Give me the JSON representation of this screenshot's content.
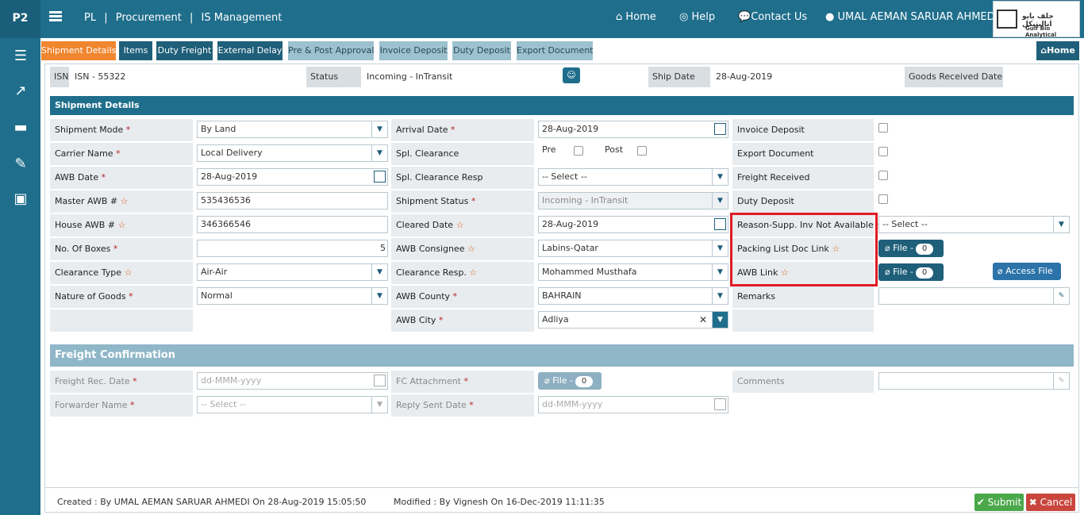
{
  "app": {
    "brand": "P2",
    "crumbs": [
      "PL",
      "|",
      "Procurement",
      "|",
      "IS Management"
    ]
  },
  "topnav": {
    "home": "Home",
    "help": "Help",
    "contact": "Contact Us",
    "user": "UMAL AEMAN SARUAR AHMEDI"
  },
  "logo": {
    "arabic": "جلف بايو اناليتيكل",
    "english": "Gulf Bio Analytical"
  },
  "tabs": [
    "Shipment Details",
    "Items",
    "Duty Freight",
    "External Delay",
    "Pre & Post Approval",
    "Invoice Deposit",
    "Duty Deposit",
    "Export Document"
  ],
  "home_button": "Home",
  "header": {
    "isn_label": "ISN",
    "isn_value": "ISN - 55322",
    "status_label": "Status",
    "status_value": "Incoming - InTransit",
    "ship_date_label": "Ship Date",
    "ship_date_value": "28-Aug-2019",
    "goods_label": "Goods Received Date"
  },
  "shipment": {
    "title": "Shipment Details",
    "col1": [
      {
        "label": "Shipment Mode",
        "mark": "*",
        "value": "By Land"
      },
      {
        "label": "Carrier Name",
        "mark": "*",
        "value": "Local Delivery"
      },
      {
        "label": "AWB Date",
        "mark": "*",
        "value": "28-Aug-2019"
      },
      {
        "label": "Master AWB #",
        "mark": "☆",
        "value": "535436536"
      },
      {
        "label": "House AWB #",
        "mark": "☆",
        "value": "346366546"
      },
      {
        "label": "No. Of Boxes",
        "mark": "*",
        "value": "5"
      },
      {
        "label": "Clearance Type",
        "mark": "☆",
        "value": "Air-Air"
      },
      {
        "label": "Nature of Goods",
        "mark": "*",
        "value": "Normal"
      }
    ],
    "col2": [
      {
        "label": "Arrival Date",
        "mark": "*",
        "value": "28-Aug-2019"
      },
      {
        "label": "Spl. Clearance",
        "mark": "",
        "value": ""
      },
      {
        "label": "Spl. Clearance Resp",
        "mark": "",
        "value": "-- Select --"
      },
      {
        "label": "Shipment Status",
        "mark": "*",
        "value": "Incoming - InTransit"
      },
      {
        "label": "Cleared Date",
        "mark": "☆",
        "value": "28-Aug-2019"
      },
      {
        "label": "AWB Consignee",
        "mark": "☆",
        "value": "Labins-Qatar"
      },
      {
        "label": "Clearance Resp.",
        "mark": "☆",
        "value": "Mohammed Musthafa"
      },
      {
        "label": "AWB County",
        "mark": "*",
        "value": "BAHRAIN"
      },
      {
        "label": "AWB City",
        "mark": "*",
        "value": "Adliya"
      }
    ],
    "pre_label": "Pre",
    "post_label": "Post",
    "col3": [
      {
        "label": "Invoice Deposit",
        "mark": ""
      },
      {
        "label": "Export Document",
        "mark": ""
      },
      {
        "label": "Freight Received",
        "mark": ""
      },
      {
        "label": "Duty Deposit",
        "mark": ""
      },
      {
        "label": "Reason-Supp. Inv Not Available",
        "mark": "☆"
      },
      {
        "label": "Packing List Doc Link",
        "mark": "☆"
      },
      {
        "label": "AWB Link",
        "mark": "☆"
      },
      {
        "label": "Remarks",
        "mark": ""
      }
    ],
    "reason_select": "-- Select --",
    "file_label": "File -",
    "file_count": "0",
    "access_file": "Access File"
  },
  "freight": {
    "title": "Freight Confirmation",
    "rec_date_label": "Freight Rec. Date",
    "rec_date_ph": "dd-MMM-yyyy",
    "forwarder_label": "Forwarder Name",
    "forwarder_value": "-- Select --",
    "fc_label": "FC Attachment",
    "fc_file": "File -",
    "fc_count": "0",
    "reply_label": "Reply Sent Date",
    "reply_ph": "dd-MMM-yyyy",
    "comments_label": "Comments",
    "mark": "*"
  },
  "footer": {
    "created": "Created : By UMAL AEMAN SARUAR AHMEDI On 28-Aug-2019 15:05:50",
    "modified": "Modified : By Vignesh On 16-Dec-2019 11:11:35",
    "submit": "Submit",
    "cancel": "Cancel"
  },
  "colors": {
    "primary": "#1f6e8c",
    "active_tab": "#f0862e",
    "submit": "#4aa84a",
    "cancel": "#c9463d",
    "highlight": "#e01b24"
  }
}
